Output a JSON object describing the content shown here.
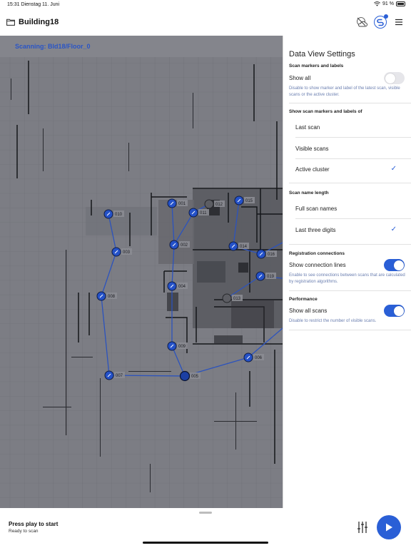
{
  "status_bar": {
    "time": "15:31",
    "date": "Dienstag 11. Juni",
    "battery": "91 %"
  },
  "nav": {
    "title": "Building18",
    "folder_icon": "folder-icon",
    "icons": [
      "cloud-off-icon",
      "sync-icon",
      "menu-icon"
    ],
    "accent": "#2a5fd6"
  },
  "map": {
    "scanning_label": "Scanning: Bld18/Floor_0",
    "scans": [
      {
        "id": "001",
        "label": "001"
      },
      {
        "id": "002",
        "label": "002"
      },
      {
        "id": "003",
        "label": "003"
      },
      {
        "id": "004",
        "label": "004"
      },
      {
        "id": "005",
        "label": "005"
      },
      {
        "id": "006",
        "label": "006"
      },
      {
        "id": "007",
        "label": "007"
      },
      {
        "id": "008",
        "label": "008"
      },
      {
        "id": "009",
        "label": "009"
      },
      {
        "id": "010",
        "label": "010"
      },
      {
        "id": "011",
        "label": "011"
      },
      {
        "id": "012",
        "label": "012"
      },
      {
        "id": "013",
        "label": "013"
      },
      {
        "id": "014",
        "label": "014"
      },
      {
        "id": "015",
        "label": "015"
      },
      {
        "id": "016",
        "label": "016"
      },
      {
        "id": "019",
        "label": "019"
      }
    ]
  },
  "settings": {
    "title": "Data View Settings",
    "scan_markers": {
      "header": "Scan markers and labels",
      "show_all_label": "Show all",
      "show_all_on": false,
      "hint": "Disable to show marker and label of the latest scan, visible scans or the active cluster."
    },
    "show_of": {
      "header": "Show scan markers and labels of",
      "options": [
        "Last scan",
        "Visible scans",
        "Active cluster"
      ],
      "selected": "Active cluster"
    },
    "name_length": {
      "header": "Scan name length",
      "options": [
        "Full scan names",
        "Last three digits"
      ],
      "selected": "Last three digits"
    },
    "registration": {
      "header": "Registration connections",
      "label": "Show connection lines",
      "on": true,
      "hint": "Enable to see connections between scans that are calculated by registration algorithms."
    },
    "performance": {
      "header": "Performance",
      "label": "Show all scans",
      "on": true,
      "hint": "Disable to restrict the number of visible scans."
    },
    "check_mark": "✓"
  },
  "bottom": {
    "title": "Press play to start",
    "subtitle": "Ready to scan",
    "icons": [
      "sliders-icon",
      "play-icon"
    ]
  }
}
